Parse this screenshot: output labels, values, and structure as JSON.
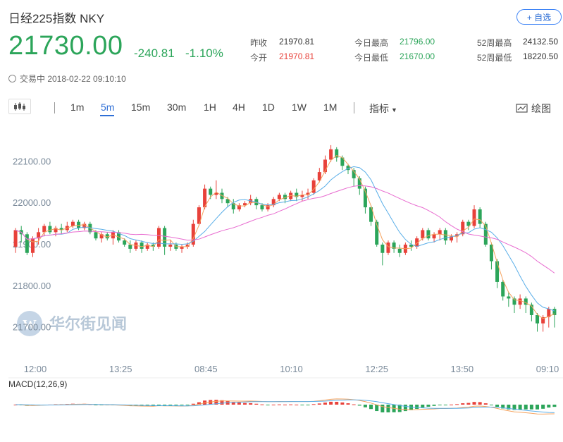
{
  "header": {
    "title": "日经225指数  NKY",
    "watch_label": "+ 自选",
    "price": "21730.00",
    "change": "-240.81",
    "change_pct": "-1.10%",
    "status": "交易中 2018-02-22 09:10:10"
  },
  "stats": [
    {
      "label": "昨收",
      "value": "21970.81",
      "color": "#333333"
    },
    {
      "label": "今开",
      "value": "21970.81",
      "color": "#e8413a"
    },
    {
      "label": "今日最高",
      "value": "21796.00",
      "color": "#2ca55a"
    },
    {
      "label": "今日最低",
      "value": "21670.00",
      "color": "#2ca55a"
    },
    {
      "label": "52周最高",
      "value": "24132.50",
      "color": "#333333"
    },
    {
      "label": "52周最低",
      "value": "18220.50",
      "color": "#333333"
    }
  ],
  "toolbar": {
    "timeframes": [
      "1m",
      "5m",
      "15m",
      "30m",
      "1H",
      "4H",
      "1D",
      "1W",
      "1M"
    ],
    "active": "5m",
    "indicator_label": "指标",
    "draw_label": "绘图"
  },
  "watermark": "华尔街见闻",
  "colors": {
    "up": "#e8413a",
    "down": "#2ca55a",
    "ma_fast": "#f5a25d",
    "ma_mid": "#5aaee8",
    "ma_slow": "#e86cd0",
    "accent": "#2f6fd6"
  },
  "chart_data": {
    "type": "candlestick",
    "y_ticks": [
      "22100.00",
      "22000.00",
      "21900.00",
      "21800.00",
      "21700.00"
    ],
    "ylim": [
      21650,
      22150
    ],
    "x_ticks": [
      "12:00",
      "13:25",
      "08:45",
      "10:10",
      "12:25",
      "13:50",
      "09:10"
    ],
    "candles": [
      [
        21895,
        21935,
        21880,
        21940
      ],
      [
        21935,
        21925,
        21905,
        21945
      ],
      [
        21925,
        21880,
        21875,
        21930
      ],
      [
        21880,
        21915,
        21870,
        21920
      ],
      [
        21915,
        21930,
        21900,
        21940
      ],
      [
        21930,
        21945,
        21920,
        21950
      ],
      [
        21945,
        21930,
        21925,
        21955
      ],
      [
        21930,
        21940,
        21920,
        21945
      ],
      [
        21940,
        21935,
        21925,
        21950
      ],
      [
        21935,
        21945,
        21930,
        21955
      ],
      [
        21945,
        21955,
        21940,
        21960
      ],
      [
        21955,
        21940,
        21935,
        21960
      ],
      [
        21940,
        21950,
        21935,
        21955
      ],
      [
        21950,
        21930,
        21925,
        21955
      ],
      [
        21930,
        21915,
        21910,
        21935
      ],
      [
        21915,
        21925,
        21905,
        21930
      ],
      [
        21925,
        21915,
        21910,
        21930
      ],
      [
        21915,
        21930,
        21900,
        21935
      ],
      [
        21930,
        21910,
        21905,
        21935
      ],
      [
        21910,
        21900,
        21895,
        21915
      ],
      [
        21900,
        21890,
        21880,
        21910
      ],
      [
        21890,
        21905,
        21885,
        21910
      ],
      [
        21905,
        21890,
        21880,
        21910
      ],
      [
        21890,
        21900,
        21885,
        21905
      ],
      [
        21900,
        21895,
        21885,
        21905
      ],
      [
        21895,
        21940,
        21890,
        21945
      ],
      [
        21940,
        21895,
        21875,
        21945
      ],
      [
        21895,
        21900,
        21885,
        21910
      ],
      [
        21900,
        21890,
        21885,
        21905
      ],
      [
        21890,
        21895,
        21880,
        21900
      ],
      [
        21895,
        21900,
        21890,
        21905
      ],
      [
        21900,
        21950,
        21895,
        21960
      ],
      [
        21950,
        21990,
        21945,
        21995
      ],
      [
        21990,
        22035,
        21985,
        22045
      ],
      [
        22035,
        22020,
        22010,
        22040
      ],
      [
        22020,
        22025,
        22010,
        22055
      ],
      [
        22025,
        22010,
        22000,
        22035
      ],
      [
        22010,
        22000,
        21990,
        22015
      ],
      [
        22000,
        21985,
        21975,
        22010
      ],
      [
        21985,
        21995,
        21980,
        22000
      ],
      [
        21995,
        22000,
        21990,
        22005
      ],
      [
        22000,
        22010,
        21995,
        22020
      ],
      [
        22010,
        21995,
        21985,
        22015
      ],
      [
        21995,
        21985,
        21980,
        22000
      ],
      [
        21985,
        21995,
        21980,
        22000
      ],
      [
        21995,
        22010,
        21990,
        22015
      ],
      [
        22010,
        22020,
        22005,
        22025
      ],
      [
        22020,
        22010,
        22000,
        22025
      ],
      [
        22010,
        22025,
        22005,
        22030
      ],
      [
        22025,
        22015,
        22005,
        22035
      ],
      [
        22015,
        22020,
        22005,
        22030
      ],
      [
        22020,
        22025,
        22010,
        22035
      ],
      [
        22025,
        22055,
        22020,
        22060
      ],
      [
        22055,
        22075,
        22050,
        22085
      ],
      [
        22075,
        22105,
        22070,
        22115
      ],
      [
        22105,
        22130,
        22100,
        22140
      ],
      [
        22130,
        22110,
        22100,
        22135
      ],
      [
        22110,
        22090,
        22080,
        22115
      ],
      [
        22090,
        22080,
        22070,
        22095
      ],
      [
        22080,
        22060,
        22040,
        22085
      ],
      [
        22060,
        22035,
        22020,
        22065
      ],
      [
        22035,
        21990,
        21975,
        22040
      ],
      [
        21990,
        21955,
        21945,
        21995
      ],
      [
        21955,
        21900,
        21895,
        21960
      ],
      [
        21900,
        21880,
        21850,
        21905
      ],
      [
        21880,
        21905,
        21875,
        21910
      ],
      [
        21905,
        21890,
        21880,
        21910
      ],
      [
        21890,
        21880,
        21870,
        21900
      ],
      [
        21880,
        21900,
        21875,
        21905
      ],
      [
        21900,
        21895,
        21885,
        21910
      ],
      [
        21895,
        21915,
        21890,
        21920
      ],
      [
        21915,
        21935,
        21910,
        21940
      ],
      [
        21935,
        21915,
        21910,
        21940
      ],
      [
        21915,
        21925,
        21905,
        21930
      ],
      [
        21925,
        21935,
        21910,
        21940
      ],
      [
        21935,
        21910,
        21900,
        21940
      ],
      [
        21910,
        21920,
        21905,
        21925
      ],
      [
        21920,
        21925,
        21905,
        21930
      ],
      [
        21925,
        21955,
        21920,
        21960
      ],
      [
        21955,
        21945,
        21935,
        21960
      ],
      [
        21945,
        21985,
        21940,
        21995
      ],
      [
        21985,
        21950,
        21940,
        21990
      ],
      [
        21950,
        21900,
        21895,
        21955
      ],
      [
        21900,
        21860,
        21840,
        21905
      ],
      [
        21860,
        21810,
        21795,
        21865
      ],
      [
        21810,
        21775,
        21765,
        21815
      ],
      [
        21775,
        21770,
        21750,
        21785
      ],
      [
        21770,
        21755,
        21735,
        21775
      ],
      [
        21755,
        21770,
        21745,
        21780
      ],
      [
        21770,
        21755,
        21735,
        21775
      ],
      [
        21755,
        21730,
        21715,
        21760
      ],
      [
        21730,
        21710,
        21690,
        21735
      ],
      [
        21710,
        21725,
        21690,
        21730
      ],
      [
        21725,
        21745,
        21700,
        21750
      ],
      [
        21745,
        21730,
        21700,
        21750
      ]
    ],
    "macd_label": "MACD(12,26,9)"
  }
}
